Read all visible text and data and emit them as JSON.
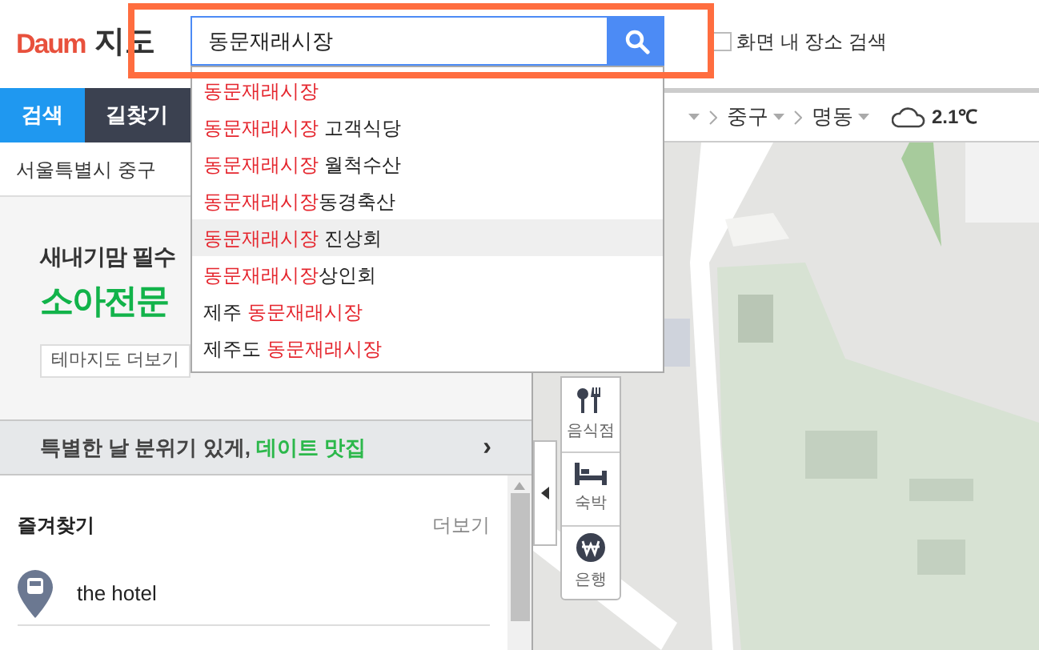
{
  "logo": {
    "wordmark": "Daum",
    "service": "지도"
  },
  "search": {
    "value": "동문재래시장"
  },
  "screen_search": {
    "label": "화면 내 장소 검색",
    "checked": false
  },
  "tabs": [
    {
      "label": "검색",
      "selected": true
    },
    {
      "label": "길찾기",
      "selected": false
    }
  ],
  "breadcrumb": [
    "중구",
    "명동"
  ],
  "weather": {
    "temperature": "2.1℃"
  },
  "suggestions": [
    {
      "selected": false,
      "parts": [
        {
          "text": "동문재래시장",
          "match": true
        }
      ]
    },
    {
      "selected": false,
      "parts": [
        {
          "text": "동문재래시장",
          "match": true
        },
        {
          "text": " 고객식당",
          "match": false
        }
      ]
    },
    {
      "selected": false,
      "parts": [
        {
          "text": "동문재래시장",
          "match": true
        },
        {
          "text": " 월척수산",
          "match": false
        }
      ]
    },
    {
      "selected": false,
      "parts": [
        {
          "text": "동문재래시장",
          "match": true
        },
        {
          "text": "동경축산",
          "match": false
        }
      ]
    },
    {
      "selected": true,
      "parts": [
        {
          "text": "동문재래시장",
          "match": true
        },
        {
          "text": " 진상회",
          "match": false
        }
      ]
    },
    {
      "selected": false,
      "parts": [
        {
          "text": "동문재래시장",
          "match": true
        },
        {
          "text": "상인회",
          "match": false
        }
      ]
    },
    {
      "selected": false,
      "parts": [
        {
          "text": "제주 ",
          "match": false
        },
        {
          "text": "동문재래시장",
          "match": true
        }
      ]
    },
    {
      "selected": false,
      "parts": [
        {
          "text": "제주도 ",
          "match": false
        },
        {
          "text": "동문재래시장",
          "match": true
        }
      ]
    }
  ],
  "location": "서울특별시 중구",
  "banner": {
    "headline": "새내기맘 필수",
    "title": "소아전문",
    "button": "테마지도 더보기"
  },
  "promo": {
    "text": "특별한 날 분위기 있게,",
    "highlight": "데이트 맛집",
    "arrow": "›"
  },
  "favorites": {
    "title": "즐겨찾기",
    "more": "더보기",
    "items": [
      {
        "kind": "bus",
        "name": "the hotel"
      }
    ]
  },
  "categories": [
    {
      "kind": "restaurant",
      "label": "음식점"
    },
    {
      "kind": "lodging",
      "label": "숙박"
    },
    {
      "kind": "bank",
      "label": "은행"
    }
  ]
}
